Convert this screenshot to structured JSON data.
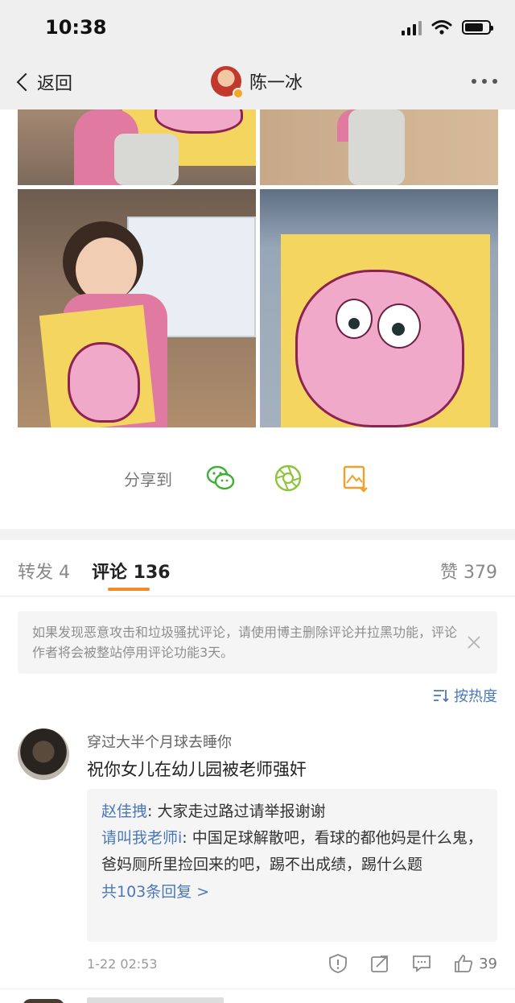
{
  "status": {
    "time": "10:38"
  },
  "nav": {
    "back_label": "返回",
    "user_name": "陈一冰"
  },
  "share": {
    "label": "分享到",
    "icons": [
      "wechat-icon",
      "moments-icon",
      "save-image-icon"
    ]
  },
  "tabs": {
    "repost_label": "转发 4",
    "comments_label": "评论 136",
    "likes_label": "赞 379"
  },
  "notice": {
    "text": "如果发现恶意攻击和垃圾骚扰评论，请使用博主删除评论并拉黑功能，评论作者将会被整站停用评论功能3天。"
  },
  "sort": {
    "label": "按热度"
  },
  "comment": {
    "user": "穿过大半个月球去睡你",
    "text": "祝你女儿在幼儿园被老师强奸",
    "replies": [
      {
        "user": "赵佳拽",
        "text": ": 大家走过路过请举报谢谢"
      },
      {
        "user": "请叫我老师i",
        "text": ": 中国足球解散吧，看球的都他妈是什么鬼，爸妈厕所里捡回来的吧，踢不出成绩，踢什么题"
      }
    ],
    "more_replies": "共103条回复 >",
    "time": "1-22 02:53",
    "like_count": "39"
  },
  "colors": {
    "accent": "#f08a2b",
    "link": "#4a78b8"
  }
}
